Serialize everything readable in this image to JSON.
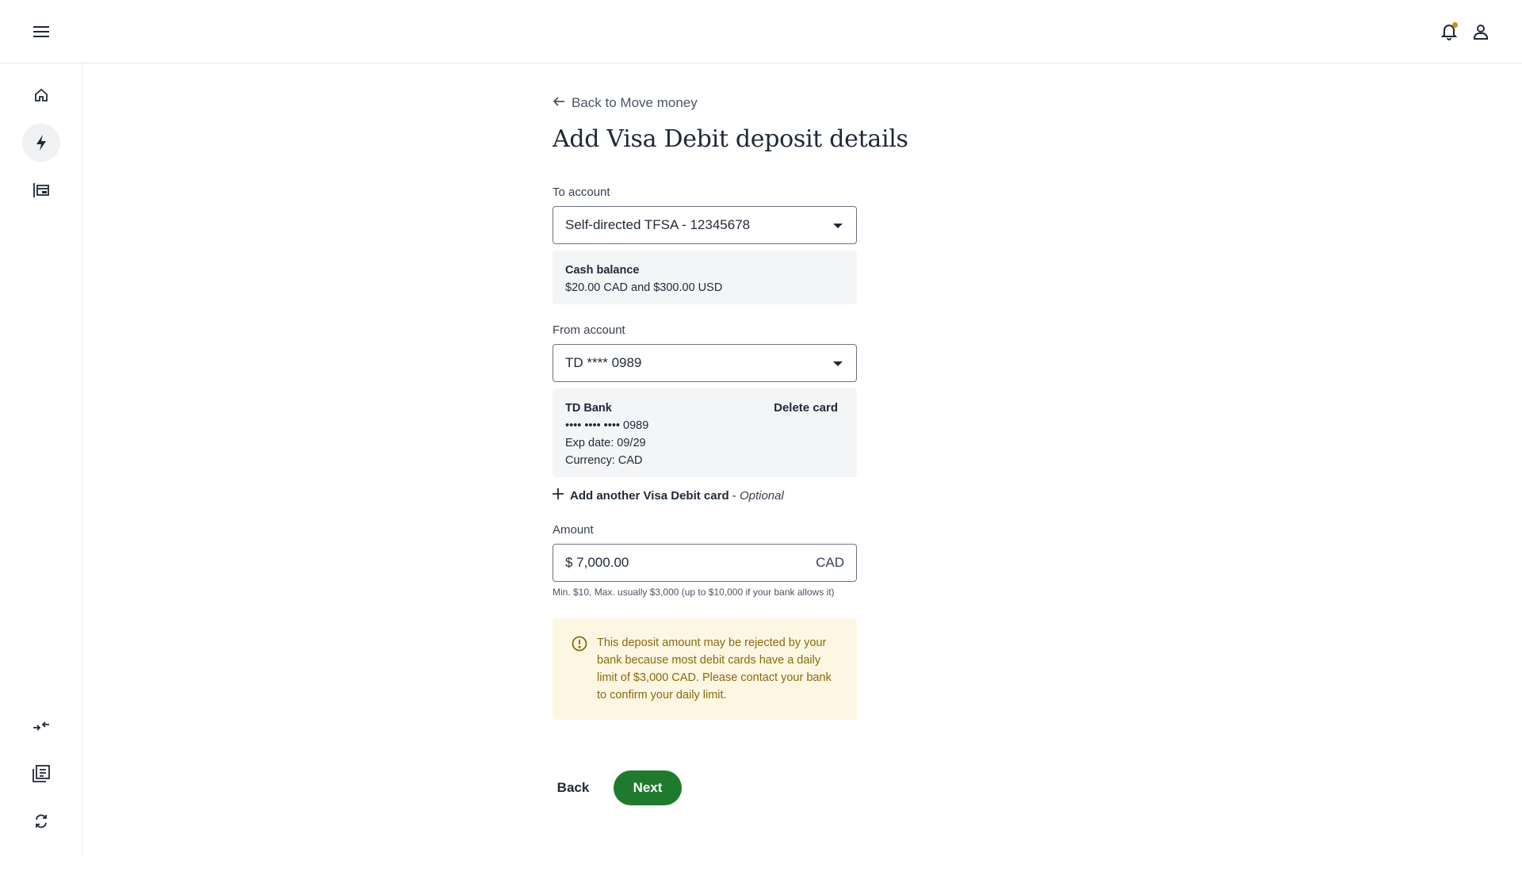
{
  "icons": {
    "menu": "menu-icon",
    "notifications": "bell-icon",
    "profile": "user-icon",
    "home": "home-icon",
    "move_money": "lightning-icon",
    "accounts": "accounts-icon",
    "transfer": "transfer-icon",
    "documents": "documents-icon",
    "recurring": "refresh-icon"
  },
  "colors": {
    "primary_button": "#1f7a2e",
    "notification_dot": "#c68a1e",
    "warning_bg": "#fdf6e3",
    "warning_text": "#8a6a0d"
  },
  "back_link": "Back to Move money",
  "page_title": "Add Visa Debit deposit details",
  "to_account": {
    "label": "To account",
    "value": "Self-directed TFSA - 12345678",
    "balance_title": "Cash balance",
    "balance_value": "$20.00 CAD and $300.00 USD"
  },
  "from_account": {
    "label": "From account",
    "value": "TD **** 0989",
    "card": {
      "bank": "TD Bank",
      "number": "•••• •••• •••• 0989",
      "exp": "Exp date: 09/29",
      "currency": "Currency: CAD",
      "delete_label": "Delete card"
    }
  },
  "add_card": {
    "label": "Add another Visa Debit card",
    "separator": " - ",
    "optional": "Optional"
  },
  "amount": {
    "label": "Amount",
    "value": "$ 7,000.00",
    "currency": "CAD",
    "helper": "Min. $10, Max. usually $3,000 (up to $10,000 if your bank allows it)"
  },
  "warning": {
    "text": "This deposit amount may be rejected by your bank because most debit cards have a daily limit of $3,000 CAD. Please contact your bank to confirm your daily limit."
  },
  "actions": {
    "back": "Back",
    "next": "Next"
  }
}
